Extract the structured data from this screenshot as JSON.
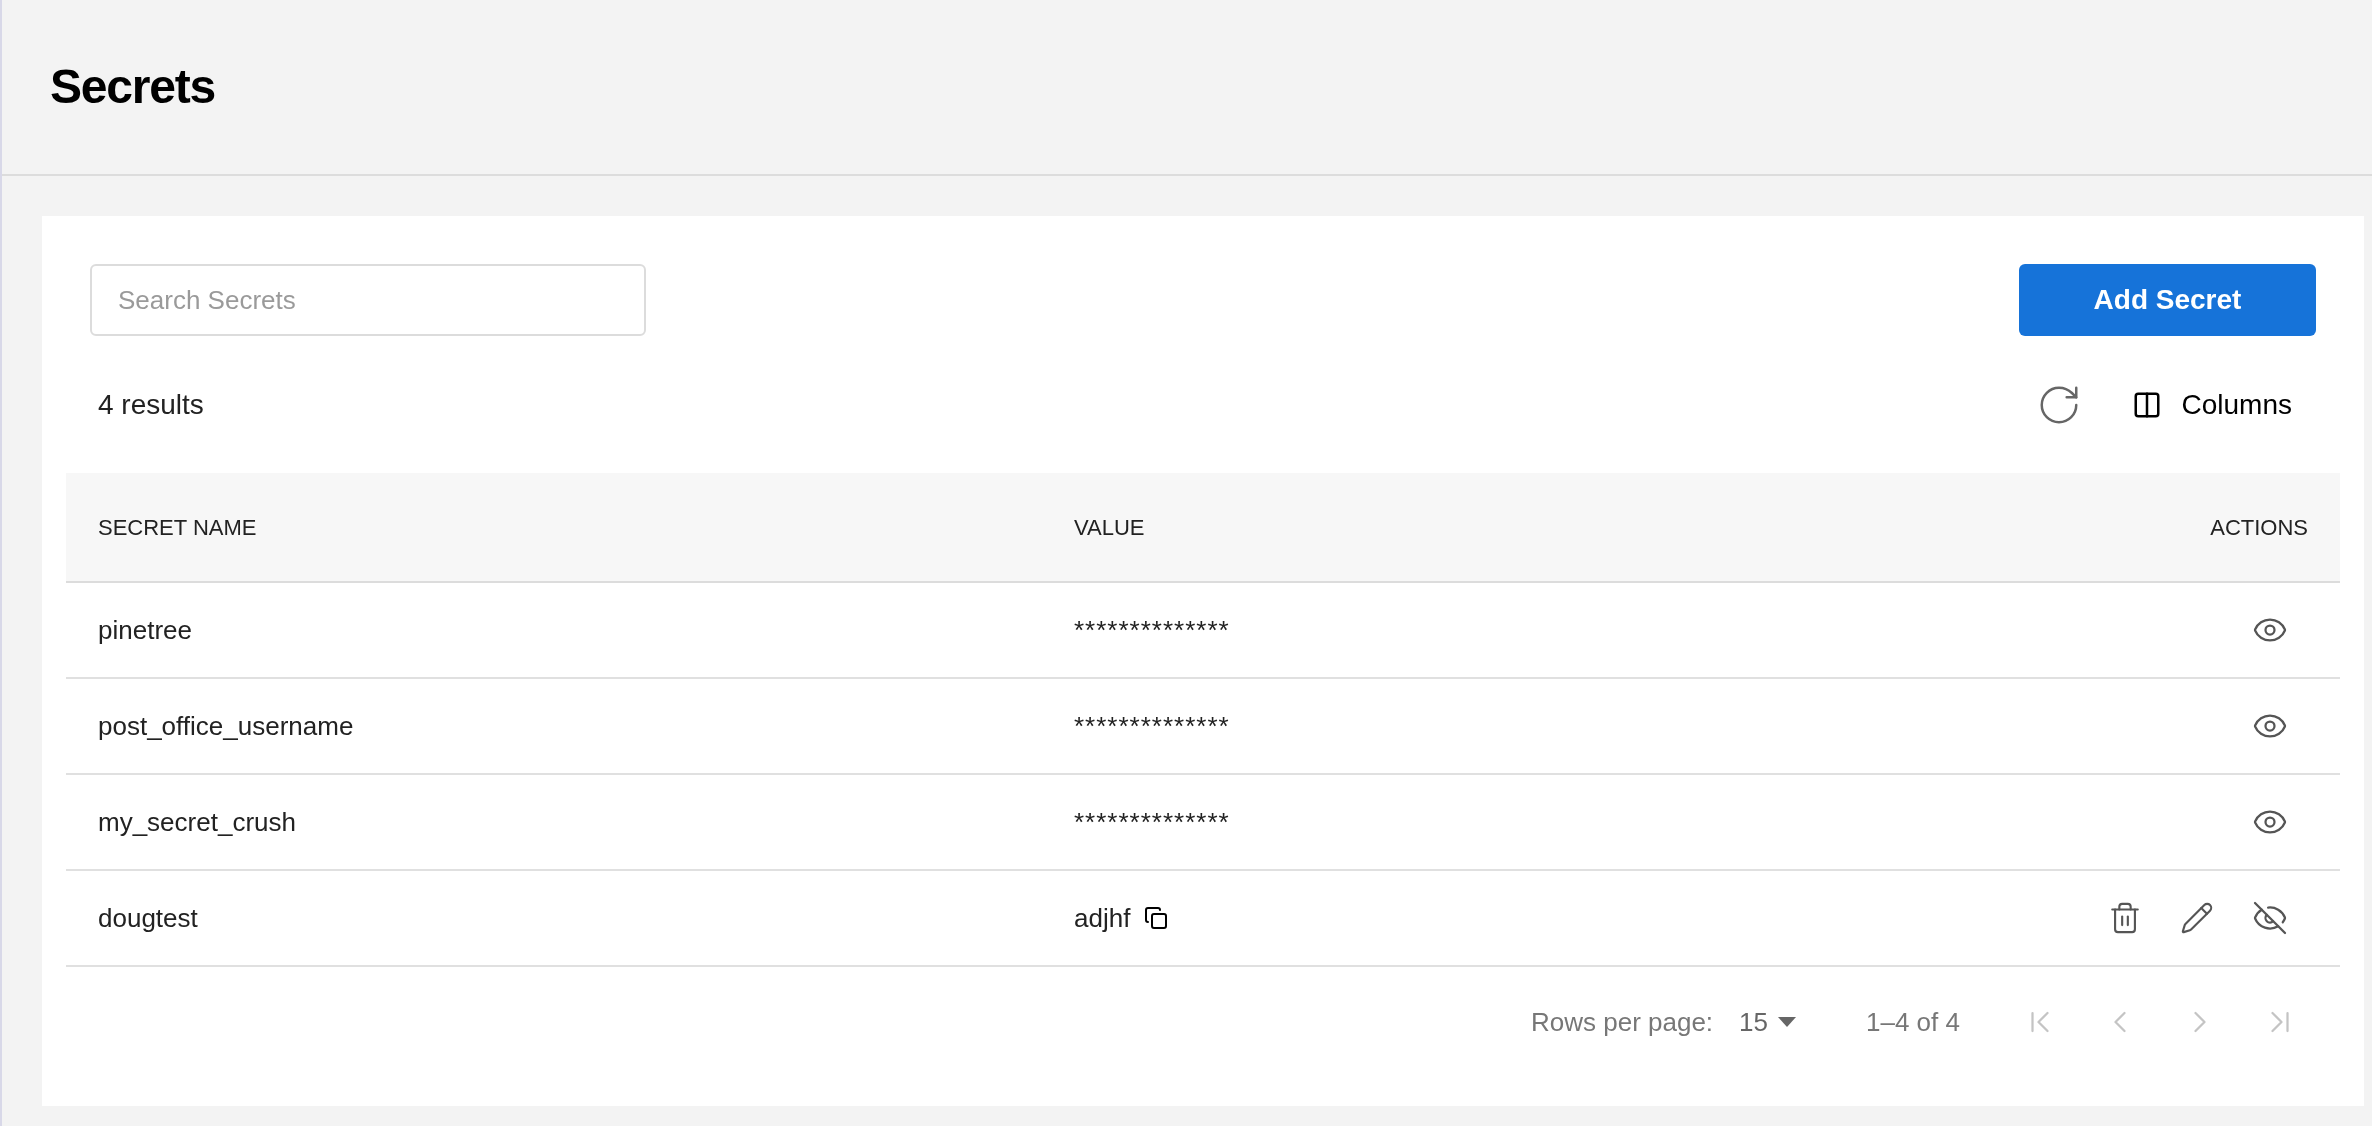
{
  "page": {
    "title": "Secrets"
  },
  "search": {
    "placeholder": "Search Secrets"
  },
  "add_button": "Add Secret",
  "results": "4 results",
  "columns_button": "Columns",
  "table": {
    "columns": [
      "SECRET NAME",
      "VALUE",
      "ACTIONS"
    ],
    "rows": [
      {
        "name": "pinetree",
        "value": "**************",
        "revealed": false
      },
      {
        "name": "post_office_username",
        "value": "**************",
        "revealed": false
      },
      {
        "name": "my_secret_crush",
        "value": "**************",
        "revealed": false
      },
      {
        "name": "dougtest",
        "value": "adjhf",
        "revealed": true
      }
    ]
  },
  "pagination": {
    "rows_per_page_label": "Rows per page:",
    "rows_per_page": "15",
    "range": "1–4 of 4",
    "buttons": [
      {
        "kind": "first",
        "disabled": true
      },
      {
        "kind": "prev",
        "disabled": true
      },
      {
        "kind": "next",
        "disabled": true
      },
      {
        "kind": "last",
        "disabled": true
      }
    ]
  }
}
